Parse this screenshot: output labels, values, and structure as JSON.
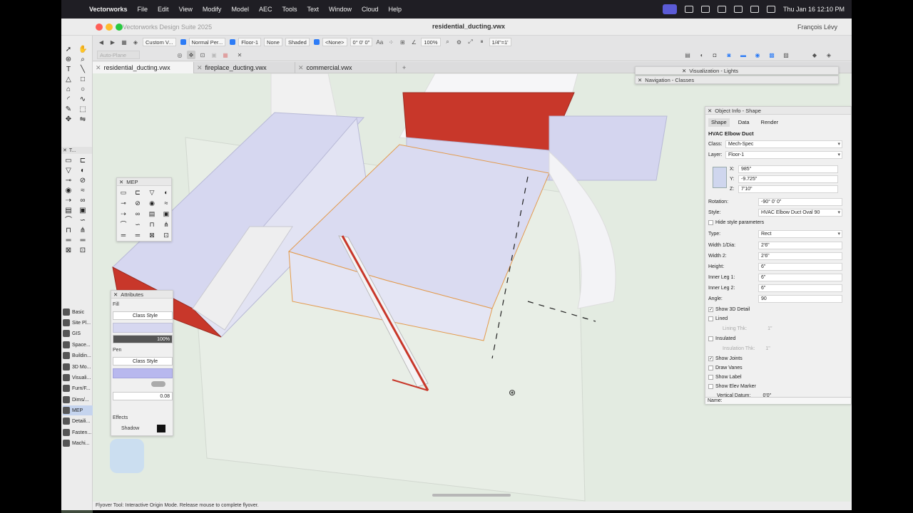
{
  "menubar": {
    "app": "Vectorworks",
    "items": [
      "File",
      "Edit",
      "View",
      "Modify",
      "Model",
      "AEC",
      "Tools",
      "Text",
      "Window",
      "Cloud",
      "Help"
    ],
    "clock": "Thu Jan 16  12:10 PM"
  },
  "window": {
    "app_title": "Vectorworks Design Suite 2025",
    "doc_title": "residential_ducting.vwx",
    "user": "François Lévy"
  },
  "toolbar": {
    "view_dropdown": "Custom V...",
    "render_dropdown": "Normal Per...",
    "layer_dropdown": "Floor-1",
    "none_dropdown": "None",
    "render_mode": "Shaded",
    "none2": "<None>",
    "angle": "0° 0' 0\"",
    "zoom": "100%",
    "scale": "1/4\"=1'",
    "auto_plane": "Auto-Plane"
  },
  "tabs": [
    "residential_ducting.vwx",
    "fireplace_ducting.vwx",
    "commercial.vwx"
  ],
  "panels": {
    "mep_title": "MEP",
    "attributes_title": "Attributes",
    "nav_title": "Navigation - Classes",
    "vis_title": "Visualization - Lights",
    "oi_title": "Object Info - Shape",
    "palette_short": "T..."
  },
  "attributes": {
    "fill_label": "Fill",
    "fill_style": "Class Style",
    "opacity": "100%",
    "pen_label": "Pen",
    "pen_style": "Class Style",
    "pen_weight": "0.08",
    "effects_label": "Effects",
    "shadow_label": "Shadow"
  },
  "workspaces": [
    "Basic",
    "Site Pl...",
    "GIS",
    "Space...",
    "Buildin...",
    "3D Mo...",
    "Visuali...",
    "Furn/F...",
    "Dims/...",
    "MEP",
    "Detaili...",
    "Fasten...",
    "Machi..."
  ],
  "object_info": {
    "tabs": [
      "Shape",
      "Data",
      "Render"
    ],
    "object_type": "HVAC Elbow Duct",
    "class_label": "Class:",
    "class": "Mech-Spec",
    "layer_label": "Layer:",
    "layer": "Floor-1",
    "x_label": "X:",
    "x": "985\"",
    "y_label": "Y:",
    "y": "-9.725\"",
    "z_label": "Z:",
    "z": "7'10\"",
    "rotation_label": "Rotation:",
    "rotation": "-90° 0' 0\"",
    "style_label": "Style:",
    "style": "HVAC Elbow Duct Oval 90",
    "hide_style": "Hide style parameters",
    "rows": [
      {
        "k": "Type:",
        "v": "Rect"
      },
      {
        "k": "Width 1/Dia:",
        "v": "2'6\""
      },
      {
        "k": "Width 2:",
        "v": "2'6\""
      },
      {
        "k": "Height:",
        "v": "6\""
      },
      {
        "k": "Inner Leg 1:",
        "v": "6\""
      },
      {
        "k": "Inner Leg 2:",
        "v": "6\""
      },
      {
        "k": "Angle:",
        "v": "90"
      }
    ],
    "show_3d": "Show 3D Detail",
    "lined": "Lined",
    "lining_thk": "Lining Thk:",
    "lining_val": "1\"",
    "insulated": "Insulated",
    "insul_thk": "Insulation Thk:",
    "insul_val": "1\"",
    "show_joints": "Show Joints",
    "draw_vanes": "Draw Vanes",
    "show_label": "Show Label",
    "show_elev": "Show Elev Marker",
    "vert_datum": "Vertical Datum:",
    "vert_val": "0'0\"",
    "name_label": "Name:"
  },
  "status": "Flyover Tool:  Interactive Origin Mode. Release mouse to complete flyover.",
  "colors": {
    "duct_face": "#dcdcf0",
    "duct_top": "#cfd0ea",
    "red": "#c8372a",
    "bg": "#e3ebe1"
  }
}
